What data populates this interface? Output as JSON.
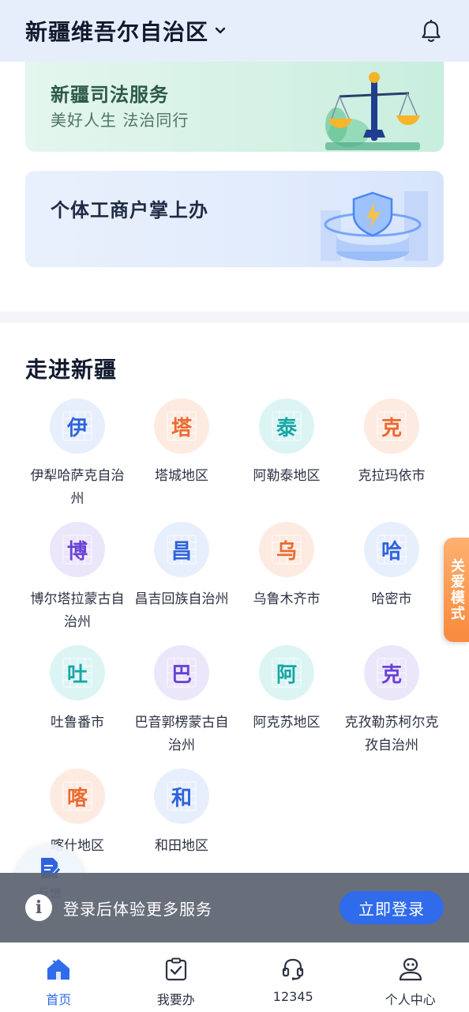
{
  "header": {
    "region": "新疆维吾尔自治区"
  },
  "banners": {
    "justice": {
      "title": "新疆司法服务",
      "subtitle": "美好人生 法治同行"
    },
    "business": {
      "title": "个体工商户掌上办"
    }
  },
  "section": {
    "title": "走进新疆"
  },
  "regions": [
    {
      "char": "伊",
      "name": "伊犁哈萨克自治州",
      "color": "blue"
    },
    {
      "char": "塔",
      "name": "塔城地区",
      "color": "orange"
    },
    {
      "char": "泰",
      "name": "阿勒泰地区",
      "color": "teal"
    },
    {
      "char": "克",
      "name": "克拉玛依市",
      "color": "orange"
    },
    {
      "char": "博",
      "name": "博尔塔拉蒙古自治州",
      "color": "purple"
    },
    {
      "char": "昌",
      "name": "昌吉回族自治州",
      "color": "blue"
    },
    {
      "char": "乌",
      "name": "乌鲁木齐市",
      "color": "orange"
    },
    {
      "char": "哈",
      "name": "哈密市",
      "color": "blue"
    },
    {
      "char": "吐",
      "name": "吐鲁番市",
      "color": "teal"
    },
    {
      "char": "巴",
      "name": "巴音郭楞蒙古自治州",
      "color": "purple"
    },
    {
      "char": "阿",
      "name": "阿克苏地区",
      "color": "teal"
    },
    {
      "char": "克",
      "name": "克孜勒苏柯尔克孜自治州",
      "color": "purple"
    },
    {
      "char": "喀",
      "name": "喀什地区",
      "color": "orange"
    },
    {
      "char": "和",
      "name": "和田地区",
      "color": "blue"
    }
  ],
  "care_mode": {
    "label": "关爱模式"
  },
  "feedback": {
    "label": "反馈"
  },
  "login_bar": {
    "text": "登录后体验更多服务",
    "button": "立即登录"
  },
  "nav": [
    {
      "label": "首页",
      "icon": "home-icon",
      "active": true
    },
    {
      "label": "我要办",
      "icon": "clipboard-check-icon",
      "active": false
    },
    {
      "label": "12345",
      "icon": "headset-icon",
      "active": false
    },
    {
      "label": "个人中心",
      "icon": "user-icon",
      "active": false
    }
  ],
  "colors": {
    "accent": "#2f6bea",
    "care": "#f88a3c",
    "header_bg": "#e6eefb"
  }
}
